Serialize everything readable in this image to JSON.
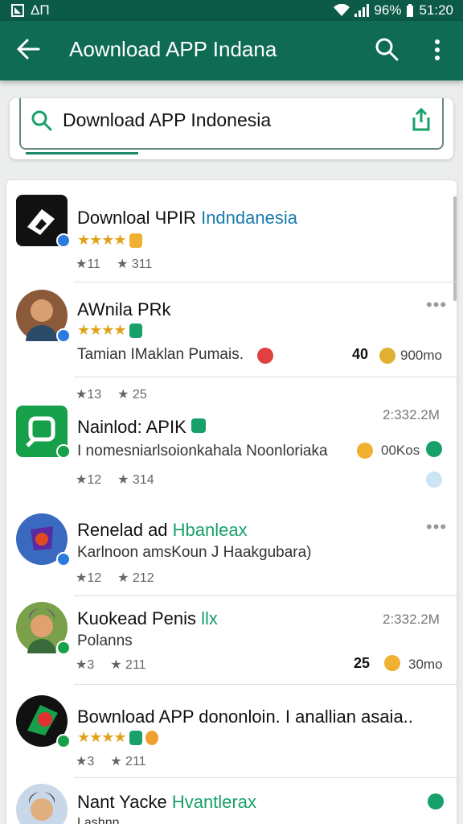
{
  "status_bar": {
    "carrier": "ΔΠ",
    "battery": "96%",
    "time": "51:20"
  },
  "app_bar": {
    "title": "Aownload APP Indana"
  },
  "search": {
    "query": "Download APP Indonesia"
  },
  "colors": {
    "primary": "#0f6b54",
    "accent": "#17a06a",
    "star": "#e0a21a",
    "link": "#1a7ab0"
  },
  "items": [
    {
      "name": "Downloal ЧPIR",
      "name_highlight": "Indndanesia",
      "stars": "★★★★",
      "meta": [
        "★11",
        "★ 311"
      ]
    },
    {
      "name": "AWnila PRk",
      "stars": "★★★★",
      "desc": "Tamian IMaklan Pumais.",
      "count": "40",
      "size": "900mo",
      "meta": [
        "★13",
        "★ 25"
      ]
    },
    {
      "name": "Nainlod: APIK",
      "time": "2:332.2M",
      "desc": "I nomesniarlsoionkahala Noonloriaka",
      "size": "00Kos",
      "meta": [
        "★12",
        "★ 314"
      ]
    },
    {
      "name": "Renelad ad",
      "name_highlight": "Hbanleax",
      "desc": "Karlnoon amsKoun J Haakgubara)",
      "meta": [
        "★12",
        "★ 212"
      ]
    },
    {
      "name": "Kuokead Penis",
      "name_highlight": "llx",
      "time": "2:332.2M",
      "desc": "Polanns",
      "count": "25",
      "size": "30mo",
      "meta": [
        "★3",
        "★ 211"
      ]
    },
    {
      "name": "Bownload APP dononloin. I anallian asaia..",
      "stars": "★★★★",
      "meta": [
        "★3",
        "★ 211"
      ]
    },
    {
      "name": "Nant Yacke",
      "name_highlight": "Hvantlerax",
      "desc": "Lashnn"
    }
  ],
  "icons": {
    "back": "arrow-left-icon",
    "search": "search-icon",
    "more": "more-vertical-icon",
    "share": "share-icon"
  }
}
